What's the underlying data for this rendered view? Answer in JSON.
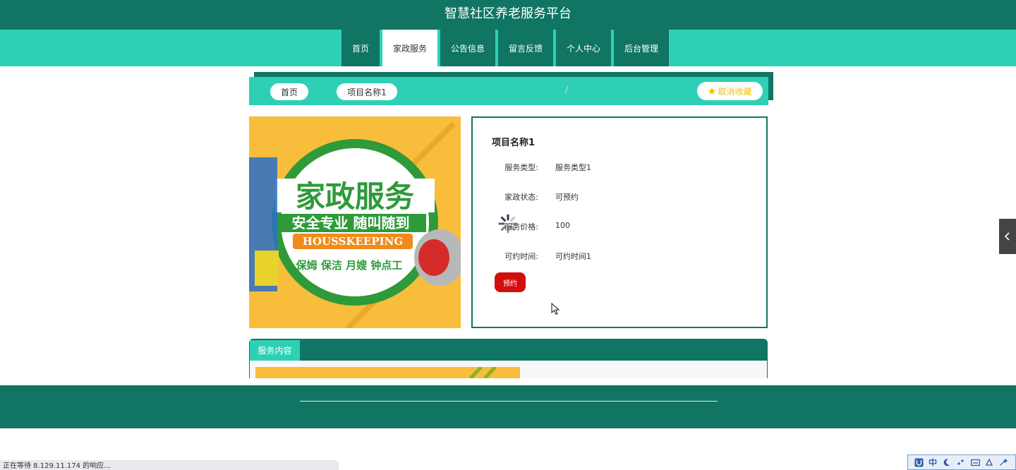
{
  "site": {
    "title": "智慧社区养老服务平台"
  },
  "nav": {
    "items": [
      {
        "label": "首页"
      },
      {
        "label": "家政服务",
        "active": true
      },
      {
        "label": "公告信息"
      },
      {
        "label": "留言反馈"
      },
      {
        "label": "个人中心"
      },
      {
        "label": "后台管理"
      }
    ]
  },
  "breadcrumb": {
    "home": "首页",
    "separator": "/",
    "current": "项目名称1",
    "favorite_label": "取消收藏"
  },
  "banner": {
    "headline": "家政服务",
    "slogan": "安全专业 随叫随到",
    "english": "HOUSSKEEPING",
    "services": "保姆 保洁 月嫂 钟点工"
  },
  "detail": {
    "title": "项目名称1",
    "rows": [
      {
        "label": "服务类型:",
        "value": "服务类型1"
      },
      {
        "label": "家政状态:",
        "value": "可预约"
      },
      {
        "label": "服务价格:",
        "value": "100"
      },
      {
        "label": "可约时间:",
        "value": "可约时间1"
      }
    ],
    "book_label": "预约"
  },
  "content": {
    "tab_label": "服务内容"
  },
  "browser": {
    "status_text": "正在等待 8.129.11.174 的响应..."
  },
  "colors": {
    "primary_dark": "#107563",
    "primary_light": "#2ed0b5",
    "book_red": "#d30e0e",
    "favorite_yellow": "#f2c200",
    "banner_yellow": "#f9bd3c",
    "banner_green": "#2f9a3a"
  },
  "icons": {
    "favorite": "star-icon",
    "side_tab": "chevron-left-icon",
    "loading": "spinner-icon",
    "pointer": "mouse-cursor-icon"
  }
}
